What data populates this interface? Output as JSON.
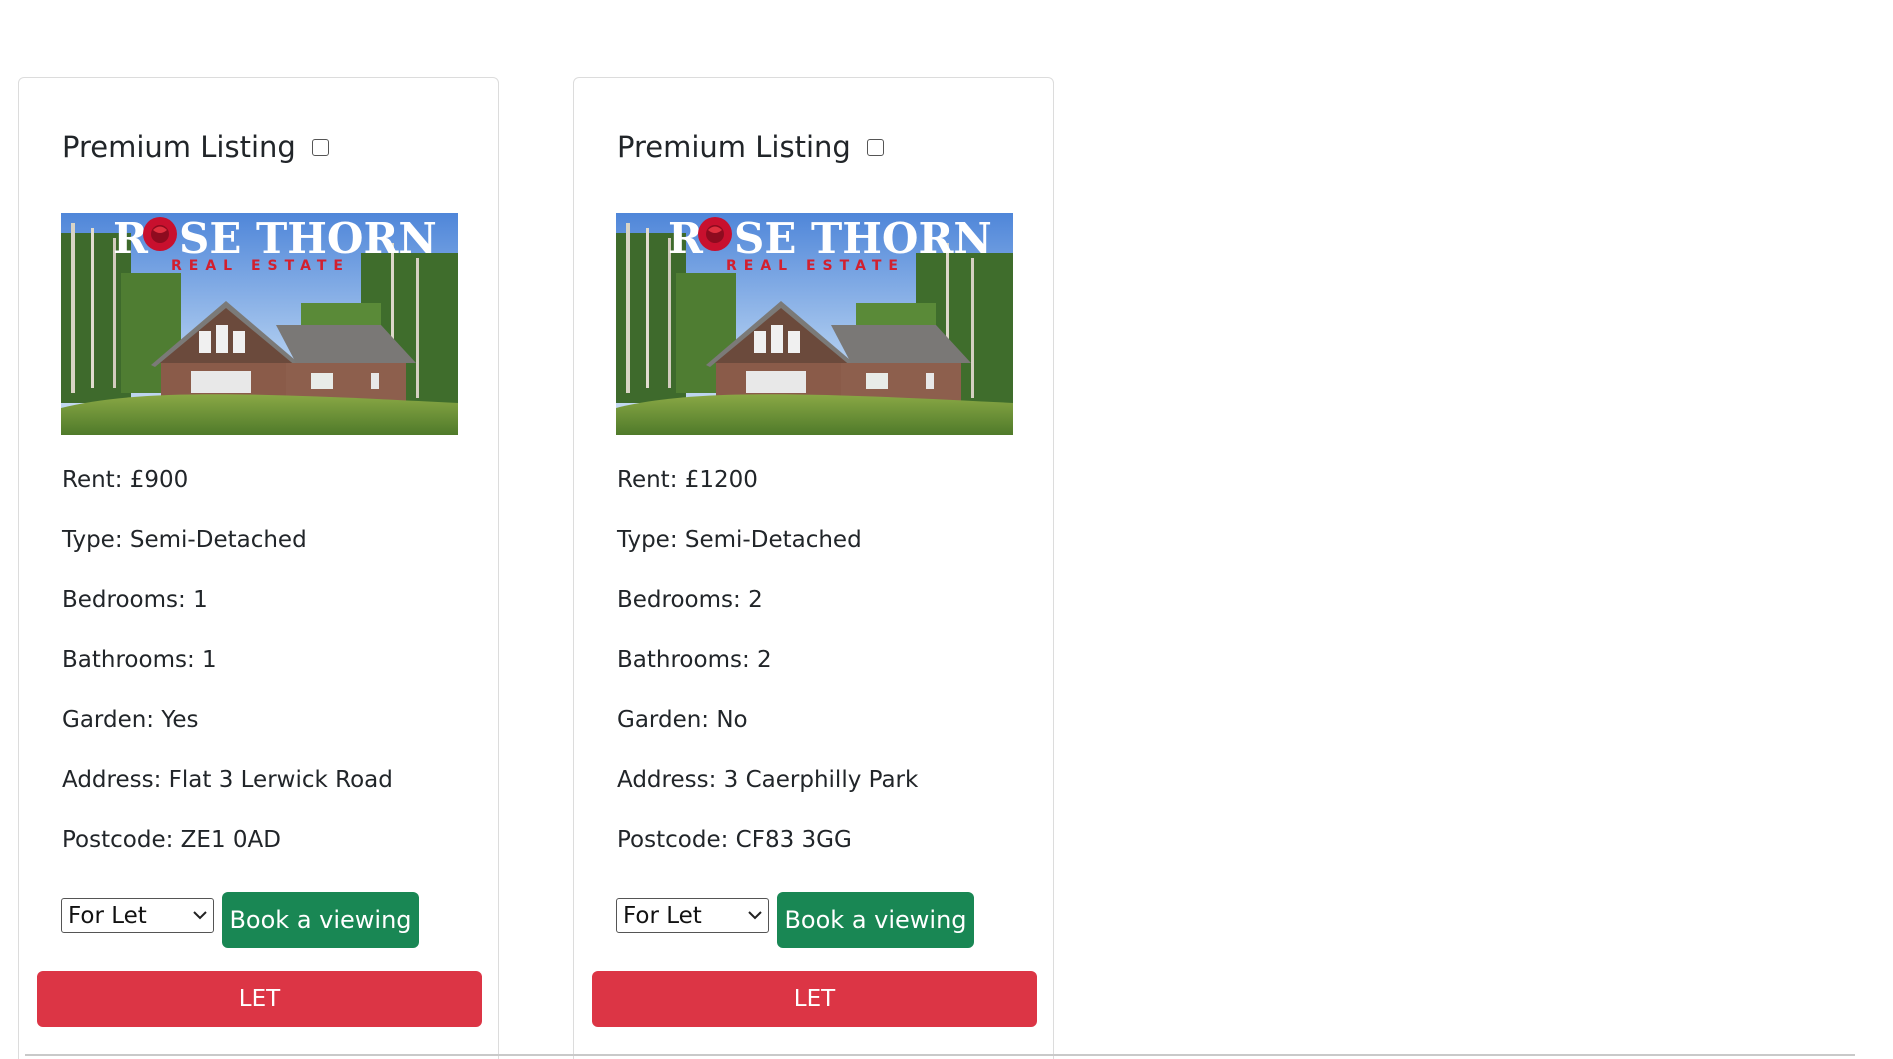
{
  "listings": [
    {
      "premium_label": "Premium Listing",
      "premium_checked": false,
      "logo": {
        "name_left": "R",
        "name_right": "SE THORN",
        "subtitle": "REAL ESTATE"
      },
      "details": [
        "Rent: £900",
        "Type: Semi-Detached",
        "Bedrooms: 1",
        "Bathrooms: 1",
        "Garden: Yes",
        "Address: Flat 3 Lerwick Road",
        "Postcode: ZE1 0AD"
      ],
      "status_select": "For Let",
      "book_label": "Book a viewing",
      "let_label": "LET"
    },
    {
      "premium_label": "Premium Listing",
      "premium_checked": false,
      "logo": {
        "name_left": "R",
        "name_right": "SE THORN",
        "subtitle": "REAL ESTATE"
      },
      "details": [
        "Rent: £1200",
        "Type: Semi-Detached",
        "Bedrooms: 2",
        "Bathrooms: 2",
        "Garden: No",
        "Address: 3 Caerphilly Park",
        "Postcode: CF83 3GG"
      ],
      "status_select": "For Let",
      "book_label": "Book a viewing",
      "let_label": "LET"
    }
  ],
  "colors": {
    "book_button": "#198754",
    "let_button": "#dc3545",
    "logo_subtitle": "#d2202f"
  }
}
